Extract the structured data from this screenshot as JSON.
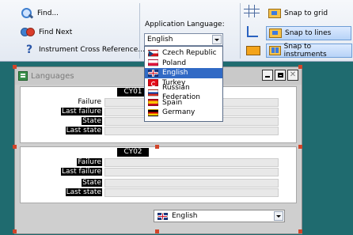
{
  "ribbon": {
    "find_label": "Find...",
    "find_next_label": "Find Next",
    "cross_ref_label": "Instrument Cross Reference...",
    "lang_label": "Application Language:",
    "lang_value": "English",
    "snap_grid": "Snap to grid",
    "snap_lines": "Snap to lines",
    "snap_instruments": "Snap to instruments"
  },
  "languages": [
    "Czech Republic",
    "Poland",
    "English",
    "Turkey",
    "Russian Federation",
    "Spain",
    "Germany"
  ],
  "window": {
    "title": "Languages",
    "panel1": {
      "title": "CY01",
      "rows": [
        "Failure",
        "Last failure",
        "State",
        "Last state"
      ]
    },
    "panel2": {
      "title": "CY02",
      "rows": [
        "Failure",
        "Last failure",
        "State",
        "Last state"
      ]
    },
    "bottom_select": "English"
  }
}
